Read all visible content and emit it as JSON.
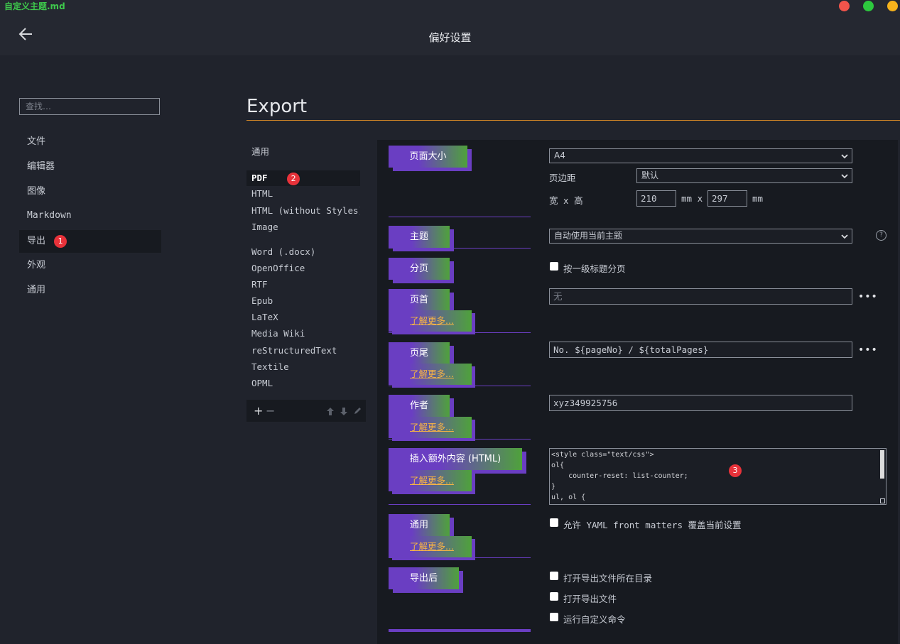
{
  "window": {
    "document_title": "自定义主题.md",
    "title": "偏好设置",
    "traffic_lights": {
      "close": "#f2544b",
      "minimize": "#2dc83e",
      "zoom": "#f5b21c"
    }
  },
  "sidebar": {
    "search_placeholder": "查找…",
    "items": [
      {
        "label": "文件"
      },
      {
        "label": "编辑器"
      },
      {
        "label": "图像"
      },
      {
        "label": "Markdown"
      },
      {
        "label": "导出",
        "badge": "1",
        "active": true
      },
      {
        "label": "外观"
      },
      {
        "label": "通用"
      }
    ]
  },
  "section": {
    "title": "Export",
    "rule_color": "#d18626"
  },
  "formats": {
    "items": [
      {
        "label": "通用"
      },
      {
        "label": "PDF",
        "badge": "2",
        "active": true
      },
      {
        "label": "HTML"
      },
      {
        "label": "HTML (without Styles)"
      },
      {
        "label": "Image"
      },
      {
        "label": "Word (.docx)"
      },
      {
        "label": "OpenOffice"
      },
      {
        "label": "RTF"
      },
      {
        "label": "Epub"
      },
      {
        "label": "LaTeX"
      },
      {
        "label": "Media Wiki"
      },
      {
        "label": "reStructuredText"
      },
      {
        "label": "Textile"
      },
      {
        "label": "OPML"
      }
    ],
    "toolbar": {
      "add": "+",
      "remove": "−"
    }
  },
  "settings": {
    "learn_more": "了解更多...",
    "page_size": {
      "label": "页面大小",
      "value": "A4",
      "margin_label": "页边距",
      "margin_value": "默认",
      "wh_label": "宽 x 高",
      "width": "210",
      "mm_x": "mm x",
      "height": "297",
      "mm": "mm"
    },
    "theme": {
      "label": "主题",
      "value": "自动使用当前主题",
      "help": "?"
    },
    "pagination": {
      "label": "分页",
      "option": "按一级标题分页"
    },
    "header": {
      "label": "页首",
      "placeholder": "无",
      "more": "•••"
    },
    "footer": {
      "label": "页尾",
      "value": "No. ${pageNo} / ${totalPages}",
      "more": "•••"
    },
    "author": {
      "label": "作者",
      "value": "xyz349925756"
    },
    "extra_html": {
      "label": "插入额外内容 (HTML)",
      "badge": "3",
      "lines": [
        "<style class=\"text/css\">",
        "ol{",
        "    counter-reset: list-counter;",
        "}",
        "ul, ol {"
      ]
    },
    "general": {
      "label": "通用",
      "option": "允许 YAML front matters 覆盖当前设置"
    },
    "after_export": {
      "label": "导出后",
      "options": [
        "打开导出文件所在目录",
        "打开导出文件",
        "运行自定义命令"
      ]
    }
  },
  "colors": {
    "accent_purple": "#6a3ec2",
    "accent_green": "#4fa23b",
    "link": "#f5b445",
    "badge": "#e8323a"
  }
}
